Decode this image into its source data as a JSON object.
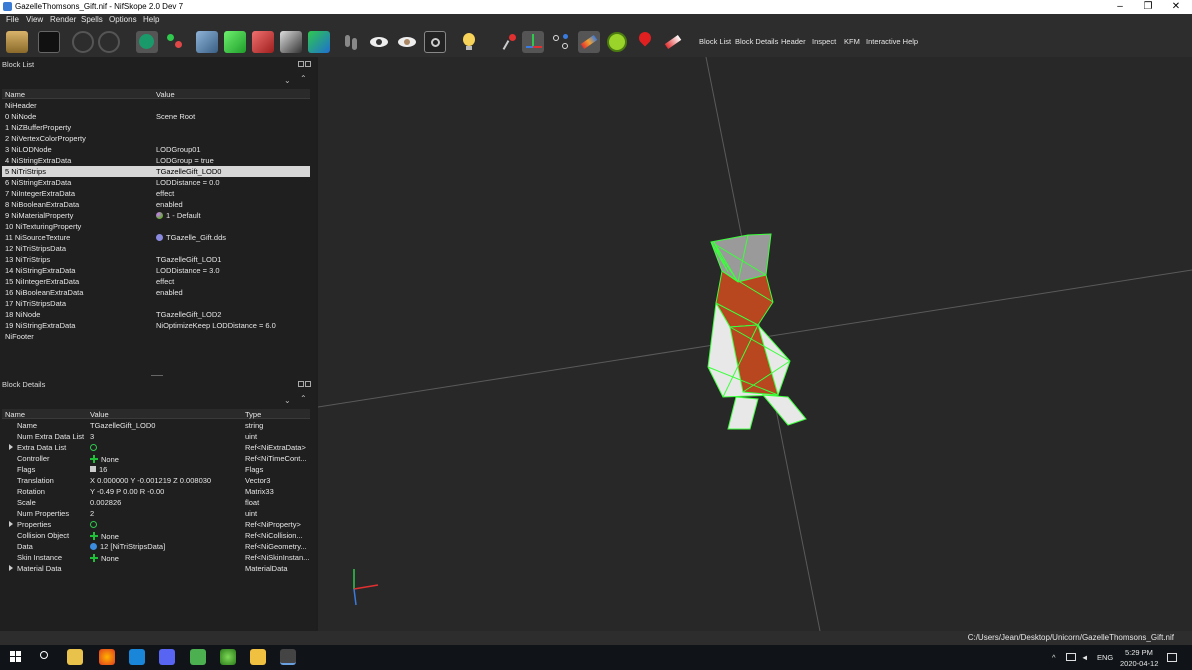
{
  "window": {
    "title": "GazelleThomsons_Gift.nif - NifSkope 2.0 Dev 7",
    "minimize": "–",
    "maximize": "❐",
    "close": "✕"
  },
  "menu": [
    "File",
    "View",
    "Render",
    "Spells",
    "Options",
    "Help"
  ],
  "toolbar": {
    "text_buttons": [
      "Block List",
      "Block Details",
      "Header",
      "Inspect",
      "KFM",
      "Interactive Help"
    ]
  },
  "block_list": {
    "title": "Block List",
    "columns": [
      "Name",
      "Value"
    ],
    "rows": [
      {
        "name": "NiHeader",
        "value": ""
      },
      {
        "name": "0 NiNode",
        "value": "Scene Root"
      },
      {
        "name": "1 NiZBufferProperty",
        "value": ""
      },
      {
        "name": "2 NiVertexColorProperty",
        "value": ""
      },
      {
        "name": "3 NiLODNode",
        "value": "LODGroup01"
      },
      {
        "name": "4 NiStringExtraData",
        "value": "LODGroup = true"
      },
      {
        "name": "5 NiTriStrips",
        "value": "TGazelleGift_LOD0"
      },
      {
        "name": "6 NiStringExtraData",
        "value": "LODDistance = 0.0"
      },
      {
        "name": "7 NiIntegerExtraData",
        "value": "effect"
      },
      {
        "name": "8 NiBooleanExtraData",
        "value": "enabled"
      },
      {
        "name": "9 NiMaterialProperty",
        "value": "1 - Default"
      },
      {
        "name": "10 NiTexturingProperty",
        "value": ""
      },
      {
        "name": "11 NiSourceTexture",
        "value": "TGazelle_Gift.dds"
      },
      {
        "name": "12 NiTriStripsData",
        "value": ""
      },
      {
        "name": "13 NiTriStrips",
        "value": "TGazelleGift_LOD1"
      },
      {
        "name": "14 NiStringExtraData",
        "value": "LODDistance = 3.0"
      },
      {
        "name": "15 NiIntegerExtraData",
        "value": "effect"
      },
      {
        "name": "16 NiBooleanExtraData",
        "value": "enabled"
      },
      {
        "name": "17 NiTriStripsData",
        "value": ""
      },
      {
        "name": "18 NiNode",
        "value": "TGazelleGift_LOD2"
      },
      {
        "name": "19 NiStringExtraData",
        "value": "NiOptimizeKeep  LODDistance = 6.0"
      },
      {
        "name": "NiFooter",
        "value": ""
      }
    ]
  },
  "block_details": {
    "title": "Block Details",
    "columns": [
      "Name",
      "Value",
      "Type"
    ],
    "rows": [
      {
        "name": "Name",
        "value": "TGazelleGift_LOD0",
        "type": "string"
      },
      {
        "name": "Num Extra Data List",
        "value": "3",
        "type": "uint"
      },
      {
        "name": "Extra Data List",
        "value": "",
        "type": "Ref<NiExtraData>"
      },
      {
        "name": "Controller",
        "value": "None",
        "type": "Ref<NiTimeCont..."
      },
      {
        "name": "Flags",
        "value": "16",
        "type": "Flags"
      },
      {
        "name": "Translation",
        "value": "X 0.000000 Y -0.001219 Z 0.008030",
        "type": "Vector3"
      },
      {
        "name": "Rotation",
        "value": "Y -0.49 P 0.00 R -0.00",
        "type": "Matrix33"
      },
      {
        "name": "Scale",
        "value": "0.002826",
        "type": "float"
      },
      {
        "name": "Num Properties",
        "value": "2",
        "type": "uint"
      },
      {
        "name": "Properties",
        "value": "",
        "type": "Ref<NiProperty>"
      },
      {
        "name": "Collision Object",
        "value": "None",
        "type": "Ref<NiCollision..."
      },
      {
        "name": "Data",
        "value": "12 [NiTriStripsData]",
        "type": "Ref<NiGeometry..."
      },
      {
        "name": "Skin Instance",
        "value": "None",
        "type": "Ref<NiSkinInstan..."
      },
      {
        "name": "Material Data",
        "value": "",
        "type": "MaterialData"
      }
    ]
  },
  "status": {
    "path": "C:/Users/Jean/Desktop/Unicorn/GazelleThomsons_Gift.nif"
  },
  "taskbar": {
    "lang": "ENG",
    "time": "5:29 PM",
    "date": "2020-04-12"
  }
}
